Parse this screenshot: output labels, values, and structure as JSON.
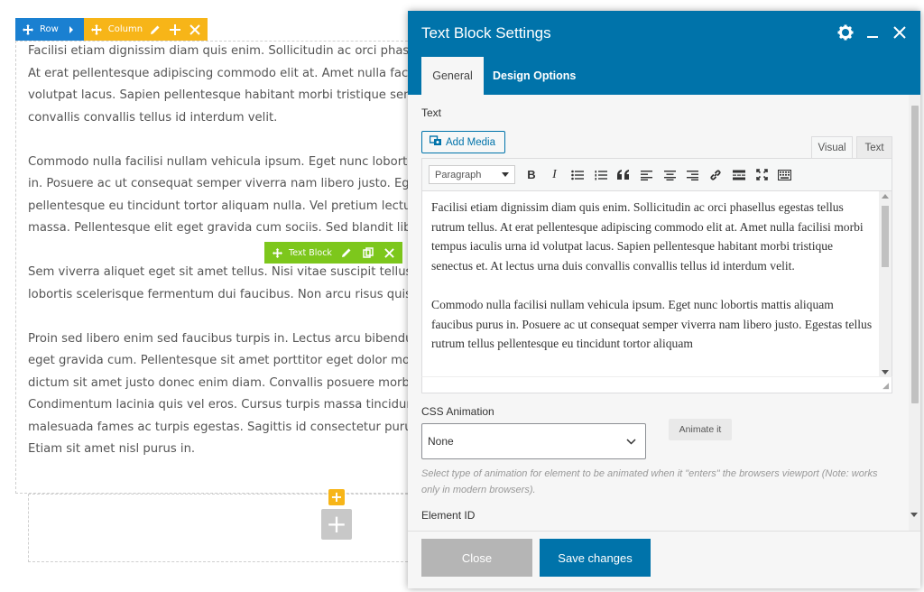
{
  "builder": {
    "row_label": "Row",
    "column_label": "Column",
    "textblock_label": "Text Block",
    "paragraphs": [
      [
        "Facilisi etiam dignissim diam quis enim. Sollicitudin ac orci phasellus egestas",
        "At erat pellentesque adipiscing commodo elit at. Amet nulla facilisi morbi tempus",
        "volutpat lacus. Sapien pellentesque habitant morbi tristique senectus et. At lectus",
        "convallis convallis tellus id interdum velit."
      ],
      [
        "Commodo nulla facilisi nullam vehicula ipsum. Eget nunc lobortis mattis aliquam",
        "in. Posuere ac ut consequat semper viverra nam libero justo. Egestas tellus rutrum",
        "pellentesque eu tincidunt tortor aliquam nulla. Vel pretium lectus quam id leo in",
        "massa. Pellentesque elit eget gravida cum sociis. Sed blandit libero volutpat sed"
      ],
      [
        "Sem viverra aliquet eget sit amet tellus. Nisi vitae suscipit tellus mauris a diam",
        "lobortis scelerisque fermentum dui faucibus. Non arcu risus quis varius quam"
      ],
      [
        "Proin sed libero enim sed faucibus turpis in. Lectus arcu bibendum at varius vel",
        "eget gravida cum. Pellentesque sit amet porttitor eget dolor morbi non arcu risus",
        "dictum sit amet justo donec enim diam. Convallis posuere morbi leo urna molestie",
        "Condimentum lacinia quis vel eros. Cursus turpis massa tincidunt dui ut ornare",
        "malesuada fames ac turpis egestas. Sagittis id consectetur purus ut faucibus",
        "Etiam sit amet nisl purus in."
      ]
    ]
  },
  "modal": {
    "title": "Text Block Settings",
    "tabs": [
      {
        "label": "General",
        "active": true
      },
      {
        "label": "Design Options",
        "active": false
      }
    ],
    "text_label": "Text",
    "add_media_label": "Add Media",
    "editor_tabs": {
      "visual": "Visual",
      "text": "Text"
    },
    "format_select": "Paragraph",
    "editor_paragraphs": [
      "Facilisi etiam dignissim diam quis enim. Sollicitudin ac orci phasellus egestas tellus rutrum tellus. At erat pellentesque adipiscing commodo elit at. Amet nulla facilisi morbi tempus iaculis urna id volutpat lacus. Sapien pellentesque habitant morbi tristique senectus et. At lectus urna duis convallis convallis tellus id interdum velit.",
      "Commodo nulla facilisi nullam vehicula ipsum. Eget nunc lobortis mattis aliquam faucibus purus in. Posuere ac ut consequat semper viverra nam libero justo. Egestas tellus rutrum tellus pellentesque eu tincidunt tortor aliquam"
    ],
    "css_animation_label": "CSS Animation",
    "css_animation_value": "None",
    "animate_button": "Animate it",
    "animation_help": "Select type of animation for element to be animated when it \"enters\" the browsers viewport (Note: works only in modern browsers).",
    "element_id_label": "Element ID",
    "close_button": "Close",
    "save_button": "Save changes"
  },
  "colors": {
    "row_blue": "#1a80d1",
    "column_orange": "#f7b518",
    "textblock_green": "#7dc71c",
    "modal_header": "#0073aa",
    "primary_button": "#0073aa"
  }
}
